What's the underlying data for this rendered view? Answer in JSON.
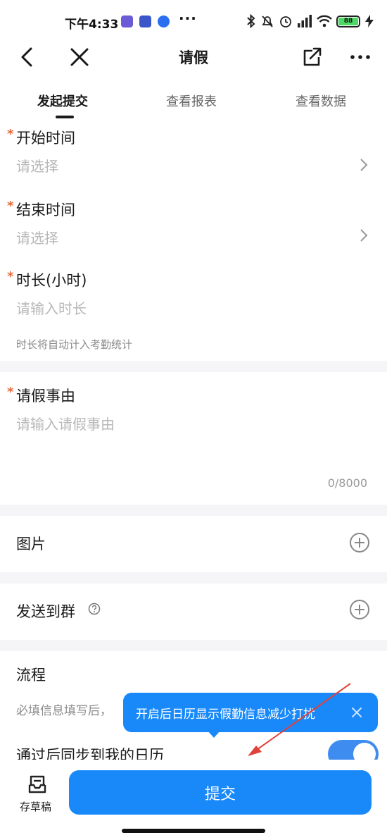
{
  "status_bar": {
    "time": "下午4:33",
    "more": "···",
    "battery": "88"
  },
  "nav": {
    "title": "请假"
  },
  "tabs": [
    {
      "label": "发起提交",
      "active": true
    },
    {
      "label": "查看报表",
      "active": false
    },
    {
      "label": "查看数据",
      "active": false
    }
  ],
  "form": {
    "start_time": {
      "label": "开始时间",
      "placeholder": "请选择",
      "required": "*"
    },
    "end_time": {
      "label": "结束时间",
      "placeholder": "请选择",
      "required": "*"
    },
    "duration": {
      "label": "时长(小时)",
      "placeholder": "请输入时长",
      "required": "*",
      "hint": "时长将自动计入考勤统计"
    },
    "reason": {
      "label": "请假事由",
      "placeholder": "请输入请假事由",
      "required": "*",
      "counter": "0/8000"
    },
    "images": {
      "label": "图片"
    },
    "send_to_group": {
      "label": "发送到群"
    },
    "process": {
      "label": "流程",
      "hint": "必填信息填写后，"
    },
    "sync_calendar": {
      "label": "通过后同步到我的日历",
      "enabled": true
    }
  },
  "tooltip": {
    "text": "开启后日历显示假勤信息减少打扰"
  },
  "bottom": {
    "draft_label": "存草稿",
    "submit_label": "提交"
  },
  "colors": {
    "accent": "#1989fa",
    "required": "#e8673a",
    "annotation_arrow": "#e0413a"
  }
}
